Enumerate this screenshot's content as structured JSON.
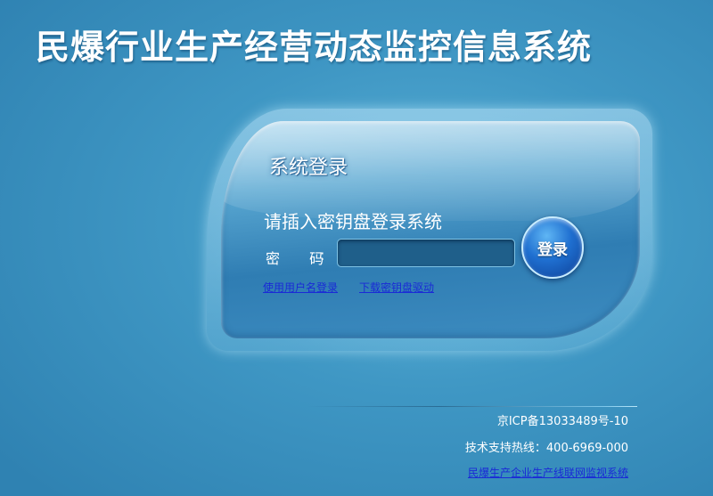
{
  "header": {
    "title": "民爆行业生产经营动态监控信息系统"
  },
  "login_panel": {
    "heading": "系统登录",
    "instruction": "请插入密钥盘登录系统",
    "password_label": "密 码",
    "password_colon": ":",
    "password_value": "",
    "login_button": "登录",
    "link_username_login": "使用用户名登录",
    "link_download_driver": "下载密钥盘驱动"
  },
  "footer": {
    "icp": "京ICP备13033489号-10",
    "hotline": "技术支持热线：400-6969-000",
    "link_monitoring": "民爆生产企业生产线联网监视系统"
  }
}
